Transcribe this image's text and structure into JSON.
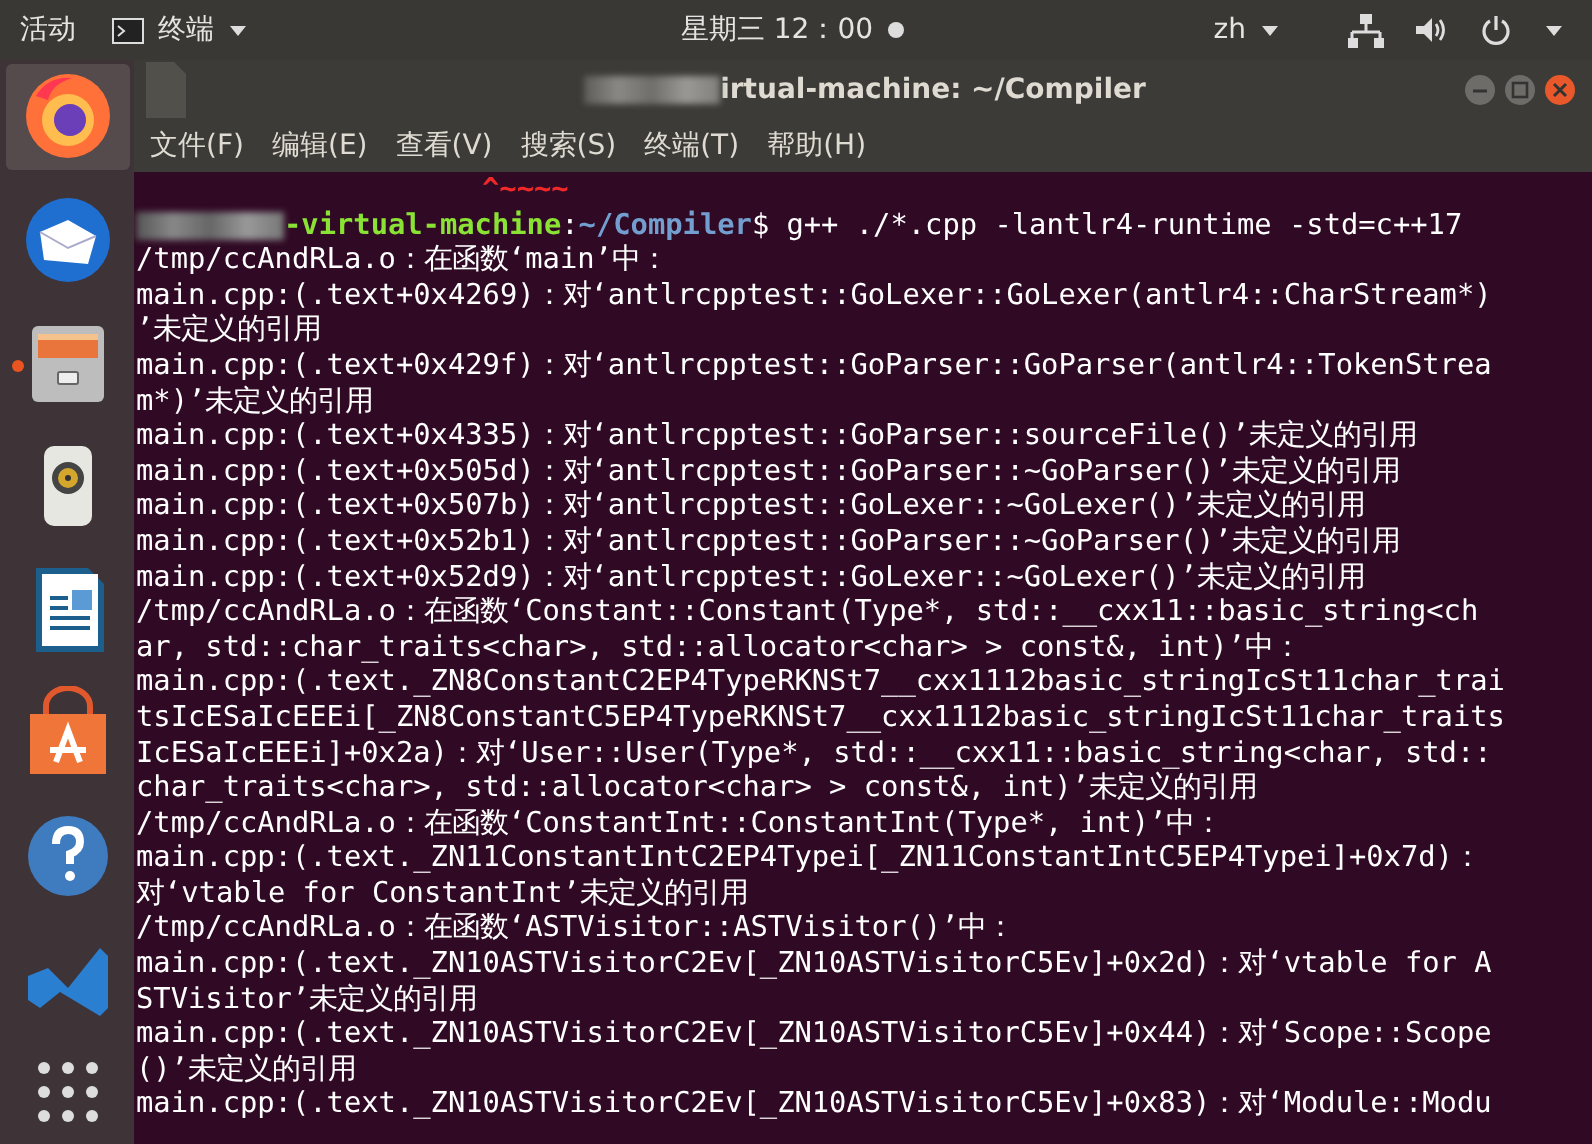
{
  "top_bar": {
    "activities": "活动",
    "app_menu": "终端",
    "clock": "星期三 12：00",
    "input_method": "zh"
  },
  "dock": {
    "items": [
      {
        "kind": "firefox",
        "selected": true,
        "running": false
      },
      {
        "kind": "mail",
        "selected": false,
        "running": false
      },
      {
        "kind": "files",
        "selected": false,
        "running": true
      },
      {
        "kind": "speaker",
        "selected": false,
        "running": false
      },
      {
        "kind": "writer",
        "selected": false,
        "running": false
      },
      {
        "kind": "store",
        "selected": false,
        "running": false
      },
      {
        "kind": "help",
        "selected": false,
        "running": false
      },
      {
        "kind": "editor",
        "selected": false,
        "running": false
      },
      {
        "kind": "grid",
        "selected": false,
        "running": false
      }
    ]
  },
  "window": {
    "title": "irtual-machine: ~/Compiler",
    "menu": [
      "文件(F)",
      "编辑(E)",
      "查看(V)",
      "搜索(S)",
      "终端(T)",
      "帮助(H)"
    ]
  },
  "terminal": {
    "lines": [
      {
        "kind": "caret",
        "text": "^~~~~"
      },
      {
        "kind": "prompt",
        "host": "-virtual-machine",
        "sep": ":",
        "path": "~/Compiler",
        "symbol": "$",
        "text": "g++ ./*.cpp -lantlr4-runtime -std=c++17"
      },
      {
        "kind": "output",
        "text": "/tmp/ccAndRLa.o：在函数‘main’中："
      },
      {
        "kind": "output",
        "text": "main.cpp:(.text+0x4269)：对‘antlrcpptest::GoLexer::GoLexer(antlr4::CharStream*)"
      },
      {
        "kind": "output",
        "text": "’未定义的引用"
      },
      {
        "kind": "output",
        "text": "main.cpp:(.text+0x429f)：对‘antlrcpptest::GoParser::GoParser(antlr4::TokenStrea"
      },
      {
        "kind": "output",
        "text": "m*)’未定义的引用"
      },
      {
        "kind": "output",
        "text": "main.cpp:(.text+0x4335)：对‘antlrcpptest::GoParser::sourceFile()’未定义的引用"
      },
      {
        "kind": "output",
        "text": "main.cpp:(.text+0x505d)：对‘antlrcpptest::GoParser::~GoParser()’未定义的引用"
      },
      {
        "kind": "output",
        "text": "main.cpp:(.text+0x507b)：对‘antlrcpptest::GoLexer::~GoLexer()’未定义的引用"
      },
      {
        "kind": "output",
        "text": "main.cpp:(.text+0x52b1)：对‘antlrcpptest::GoParser::~GoParser()’未定义的引用"
      },
      {
        "kind": "output",
        "text": "main.cpp:(.text+0x52d9)：对‘antlrcpptest::GoLexer::~GoLexer()’未定义的引用"
      },
      {
        "kind": "output",
        "text": "/tmp/ccAndRLa.o：在函数‘Constant::Constant(Type*, std::__cxx11::basic_string<ch"
      },
      {
        "kind": "output",
        "text": "ar, std::char_traits<char>, std::allocator<char> > const&, int)’中："
      },
      {
        "kind": "output",
        "text": "main.cpp:(.text._ZN8ConstantC2EP4TypeRKNSt7__cxx1112basic_stringIcSt11char_trai"
      },
      {
        "kind": "output",
        "text": "tsIcESaIcEEEi[_ZN8ConstantC5EP4TypeRKNSt7__cxx1112basic_stringIcSt11char_traits"
      },
      {
        "kind": "output",
        "text": "IcESaIcEEEi]+0x2a)：对‘User::User(Type*, std::__cxx11::basic_string<char, std::"
      },
      {
        "kind": "output",
        "text": "char_traits<char>, std::allocator<char> > const&, int)’未定义的引用"
      },
      {
        "kind": "output",
        "text": "/tmp/ccAndRLa.o：在函数‘ConstantInt::ConstantInt(Type*, int)’中："
      },
      {
        "kind": "output",
        "text": "main.cpp:(.text._ZN11ConstantIntC2EP4Typei[_ZN11ConstantIntC5EP4Typei]+0x7d)："
      },
      {
        "kind": "output",
        "text": "对‘vtable for ConstantInt’未定义的引用"
      },
      {
        "kind": "output",
        "text": "/tmp/ccAndRLa.o：在函数‘ASTVisitor::ASTVisitor()’中："
      },
      {
        "kind": "output",
        "text": "main.cpp:(.text._ZN10ASTVisitorC2Ev[_ZN10ASTVisitorC5Ev]+0x2d)：对‘vtable for A"
      },
      {
        "kind": "output",
        "text": "STVisitor’未定义的引用"
      },
      {
        "kind": "output",
        "text": "main.cpp:(.text._ZN10ASTVisitorC2Ev[_ZN10ASTVisitorC5Ev]+0x44)：对‘Scope::Scope"
      },
      {
        "kind": "output",
        "text": "()’未定义的引用"
      },
      {
        "kind": "output",
        "text": "main.cpp:(.text._ZN10ASTVisitorC2Ev[_ZN10ASTVisitorC5Ev]+0x83)：对‘Module::Modu"
      }
    ]
  }
}
